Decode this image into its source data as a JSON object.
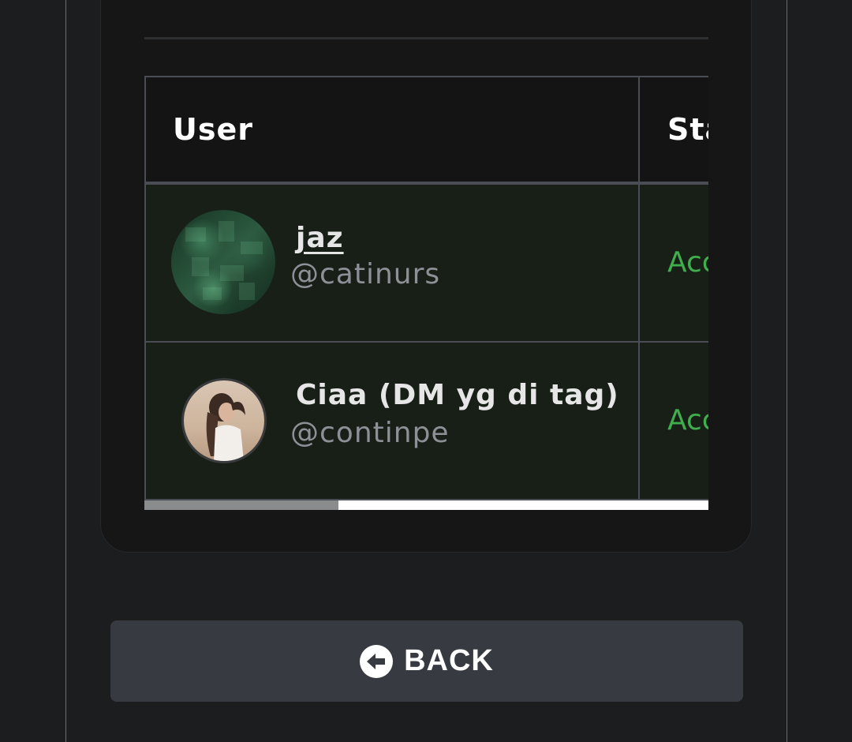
{
  "table": {
    "headers": {
      "user": "User",
      "status": "Status"
    },
    "rows": [
      {
        "name": "jaz",
        "handle": "@catinurs",
        "status": "Accepted",
        "avatar": "green-collage-avatar"
      },
      {
        "name": "Ciaa (DM yg di tag)",
        "handle": "@continpe",
        "status": "Accepted",
        "avatar": "woman-portrait-avatar"
      }
    ]
  },
  "back_button": {
    "label": "BACK",
    "icon": "arrow-left-circle-icon"
  },
  "colors": {
    "background": "#1c1d1f",
    "card": "#161617",
    "row_background": "#171f17",
    "status_green": "#3fae4b",
    "button": "#373a40"
  }
}
